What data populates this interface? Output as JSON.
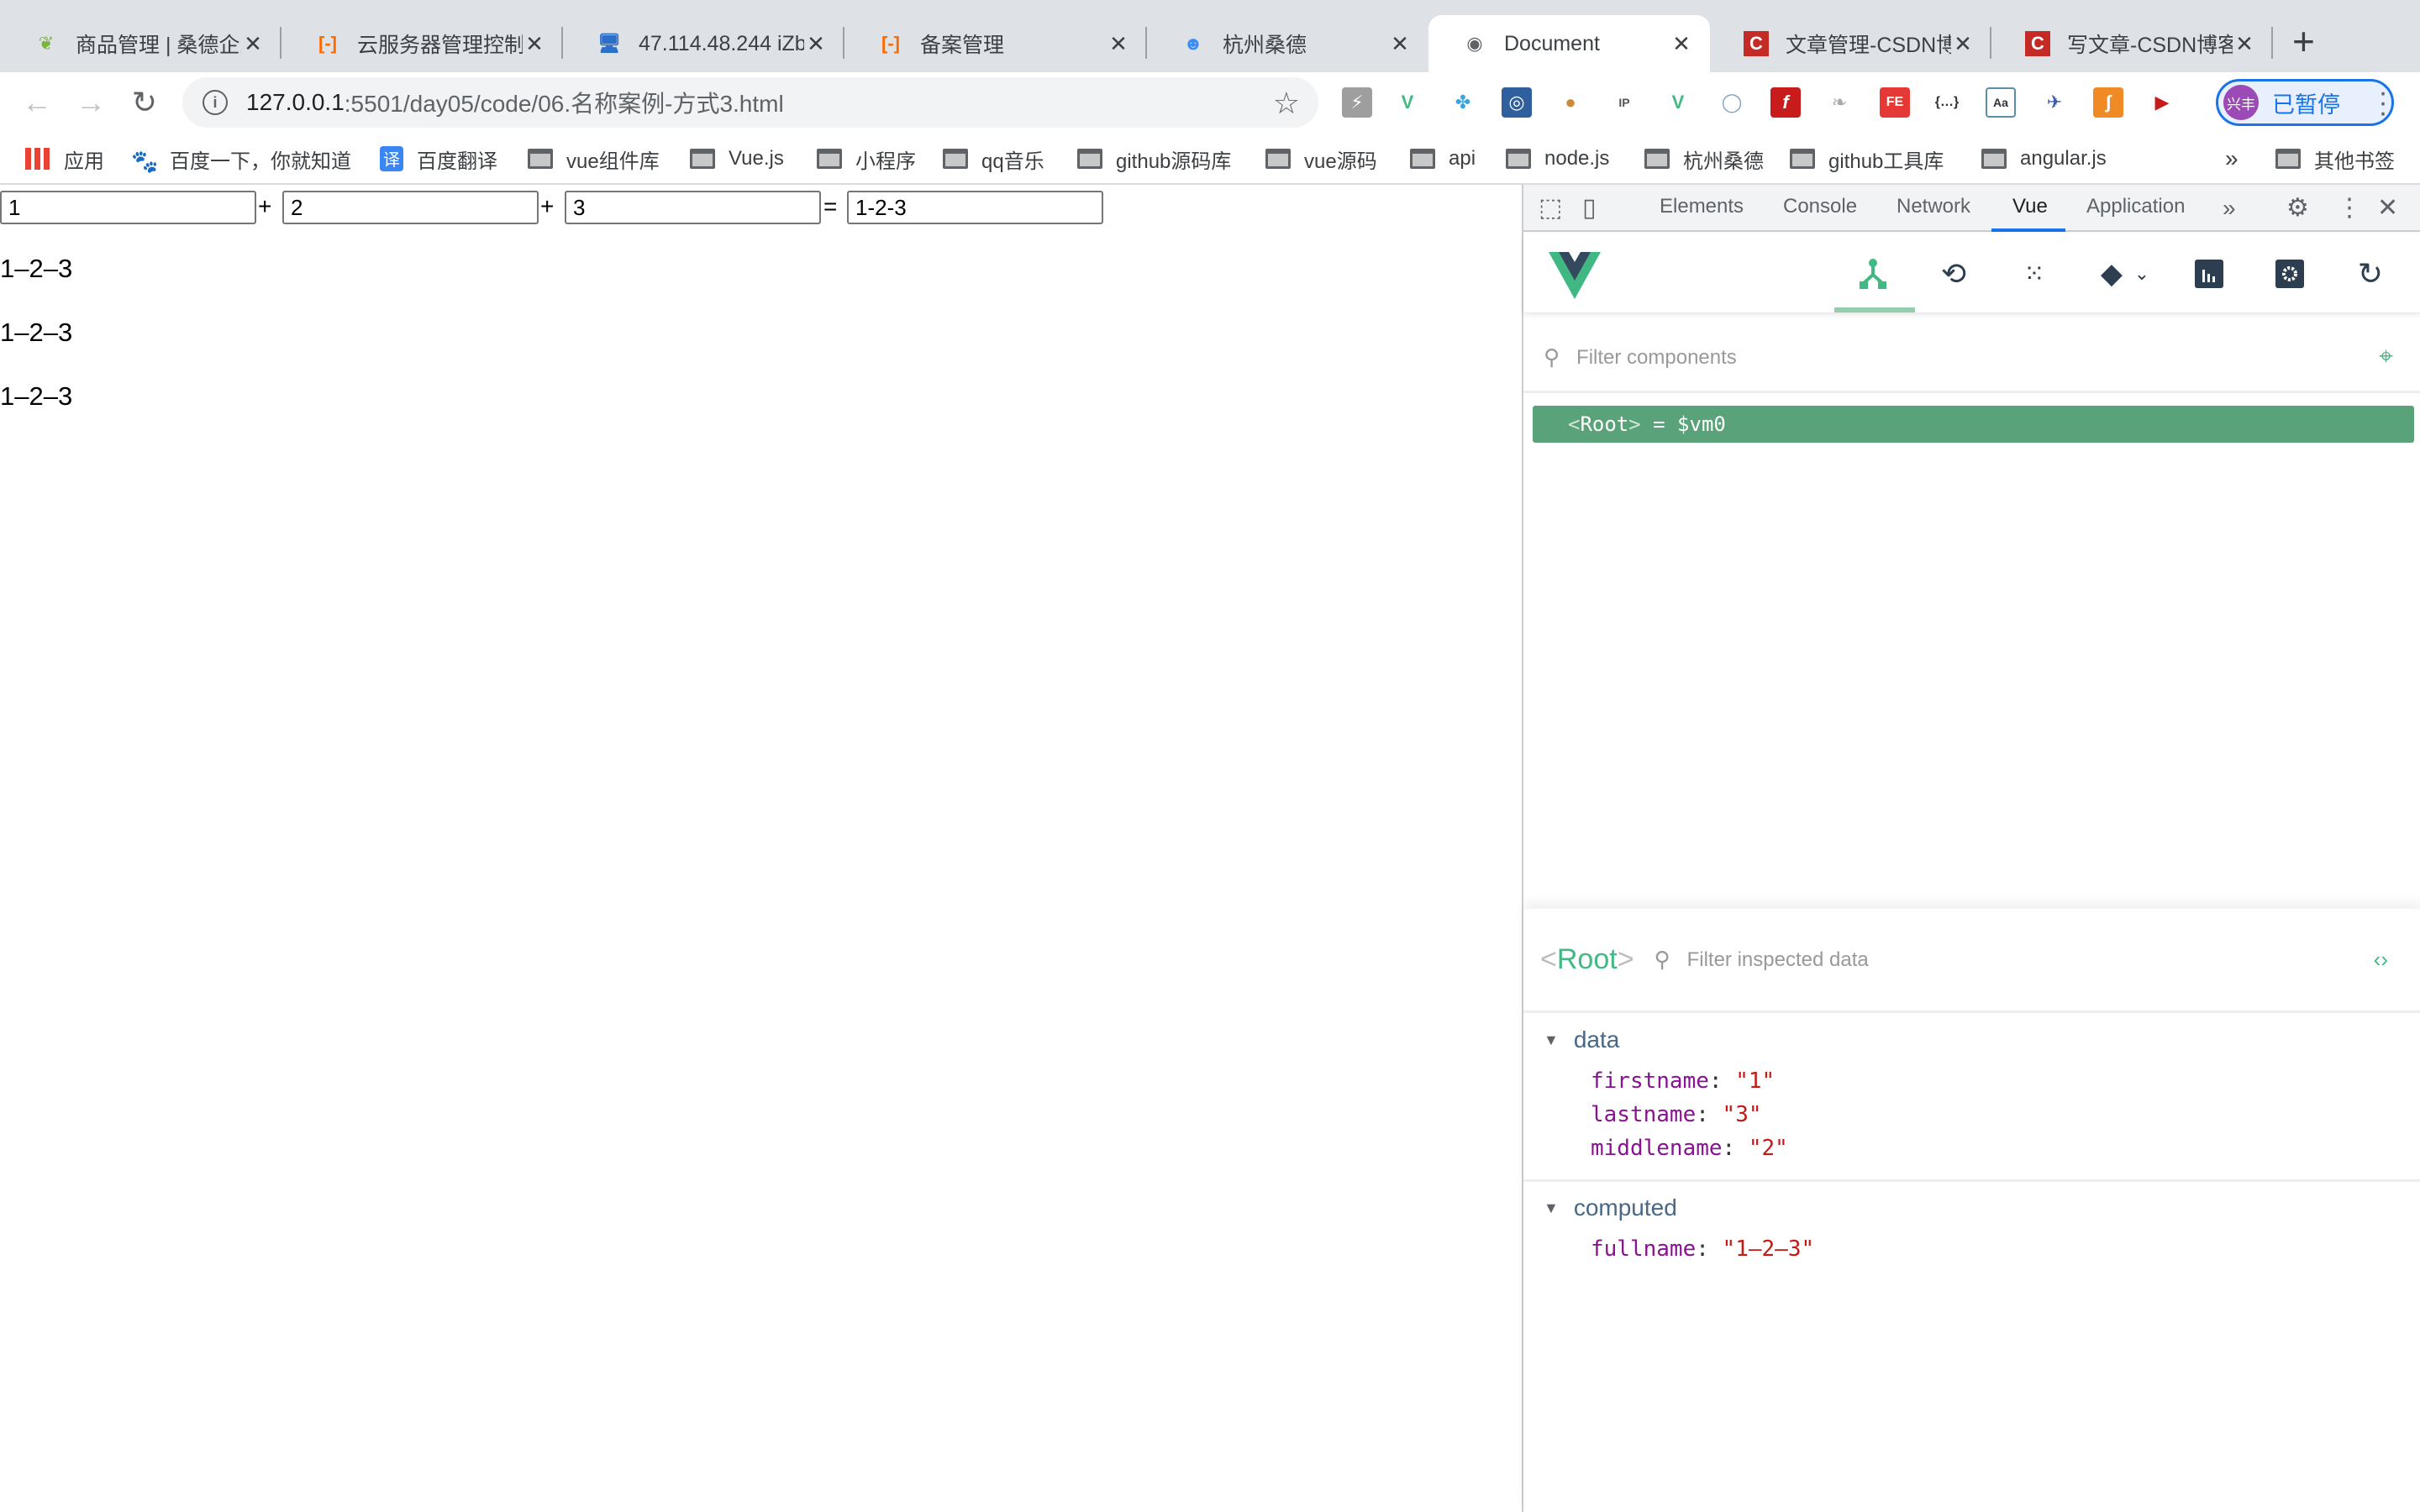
{
  "tabs": [
    {
      "label": "商品管理 | 桑德企业",
      "icon": "leaf-logo-icon",
      "active": false
    },
    {
      "label": "云服务器管理控制台",
      "icon": "aliyun-icon",
      "active": false
    },
    {
      "label": "47.114.48.244 iZb",
      "icon": "computer-icon",
      "active": false
    },
    {
      "label": "备案管理",
      "icon": "aliyun-icon",
      "active": false
    },
    {
      "label": "杭州桑德",
      "icon": "mascot-icon",
      "active": false
    },
    {
      "label": "Document",
      "icon": "globe-icon",
      "active": true
    },
    {
      "label": "文章管理-CSDN博客",
      "icon": "csdn-icon",
      "active": false
    },
    {
      "label": "写文章-CSDN博客",
      "icon": "csdn-icon",
      "active": false
    }
  ],
  "address": {
    "host": "127.0.0.1",
    "path": ":5501/day05/code/06.名称案例-方式3.html"
  },
  "profile": {
    "avatar_text": "兴丰",
    "label": "已暂停"
  },
  "bookmarks": [
    {
      "label": "应用",
      "type": "apps"
    },
    {
      "label": "百度一下，你就知道",
      "type": "baidu"
    },
    {
      "label": "百度翻译",
      "type": "translate"
    },
    {
      "label": "vue组件库",
      "type": "folder"
    },
    {
      "label": "Vue.js",
      "type": "folder"
    },
    {
      "label": "小程序",
      "type": "folder"
    },
    {
      "label": "qq音乐",
      "type": "folder"
    },
    {
      "label": "github源码库",
      "type": "folder"
    },
    {
      "label": "vue源码",
      "type": "folder"
    },
    {
      "label": "api",
      "type": "folder"
    },
    {
      "label": "node.js",
      "type": "folder"
    },
    {
      "label": "杭州桑德",
      "type": "folder"
    },
    {
      "label": "github工具库",
      "type": "folder"
    },
    {
      "label": "angular.js",
      "type": "folder"
    },
    {
      "label": "其他书签",
      "type": "folder"
    }
  ],
  "bookmarks_overflow": "»",
  "page": {
    "inputs": [
      "1",
      "2",
      "3",
      "1-2-3"
    ],
    "operators": [
      "+",
      "+",
      "="
    ],
    "outputs": [
      "1–2–3",
      "1–2–3",
      "1–2–3"
    ]
  },
  "devtools": {
    "tabs": [
      "Elements",
      "Console",
      "Network",
      "Vue",
      "Application"
    ],
    "active_tab": "Vue",
    "more": "»",
    "filter_components_placeholder": "Filter components",
    "root_row": {
      "name": "Root",
      "suffix": "= $vm0"
    },
    "inspect": {
      "component": "Root",
      "filter_placeholder": "Filter inspected data",
      "sections": [
        {
          "title": "data",
          "props": [
            {
              "key": "firstname",
              "value": "\"1\""
            },
            {
              "key": "lastname",
              "value": "\"3\""
            },
            {
              "key": "middlename",
              "value": "\"2\""
            }
          ]
        },
        {
          "title": "computed",
          "props": [
            {
              "key": "fullname",
              "value": "\"1–2–3\""
            }
          ]
        }
      ]
    }
  }
}
